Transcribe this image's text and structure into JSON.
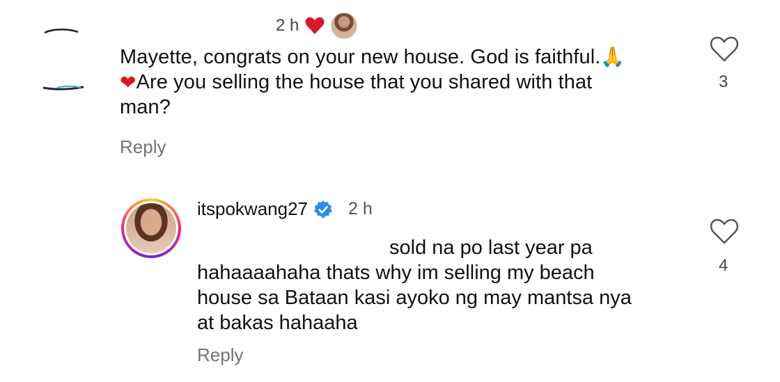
{
  "comment": {
    "time": "2 h",
    "text_line1": "Mayette, congrats on your new house. God is faithful.",
    "text_line2": "Are you selling the house that you shared with that",
    "text_line3": "man?",
    "reply_label": "Reply",
    "like_count": "3"
  },
  "reply": {
    "username": "itspokwang27",
    "time": "2 h",
    "text_line1": "sold na po last year pa",
    "text_line2": "hahaaaahaha thats why im selling my beach",
    "text_line3": "house sa Bataan kasi ayoko ng may mantsa nya",
    "text_line4": "at bakas hahaaha",
    "reply_label": "Reply",
    "like_count": "4"
  },
  "icons": {
    "heart_outline": "heart-outline-icon",
    "heart_filled": "heart-filled-icon",
    "verified": "verified-badge-icon",
    "pray": "praying-hands-emoji"
  },
  "colors": {
    "heart_red": "#d3192b",
    "verified_blue": "#2d8cf0",
    "muted_text": "#737373"
  }
}
